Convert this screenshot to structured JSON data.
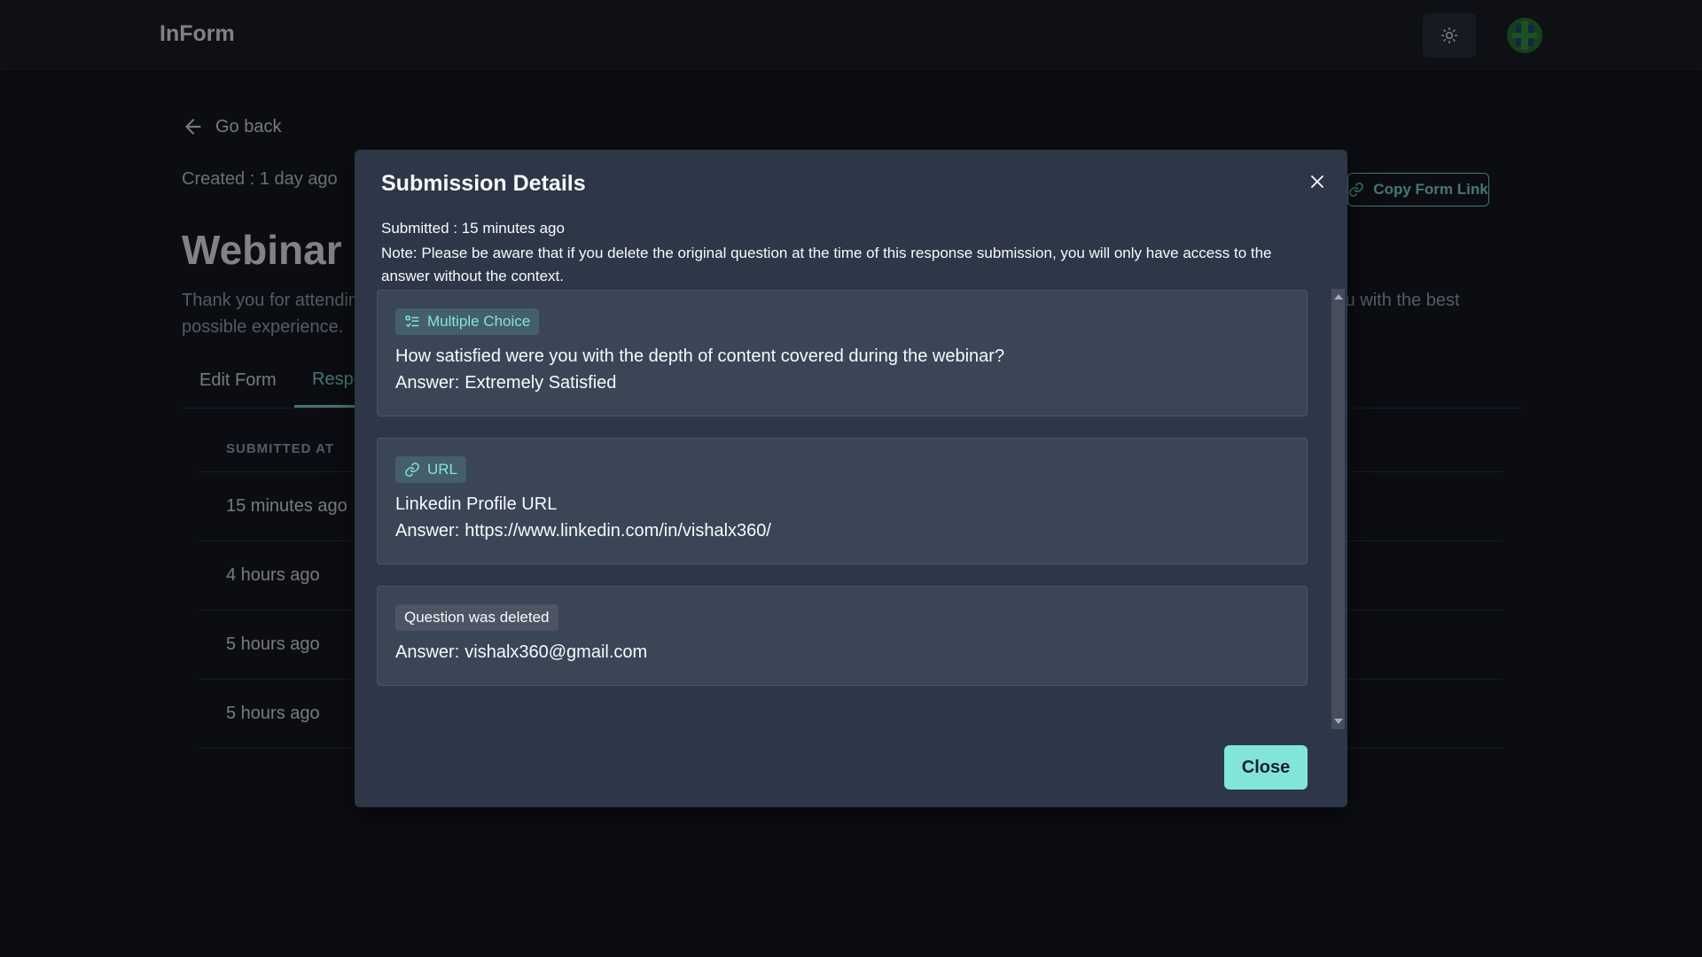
{
  "header": {
    "brand": "InForm",
    "theme_icon": "sun-icon",
    "avatar_icon": "user-avatar"
  },
  "page": {
    "go_back": "Go back",
    "created": "Created : 1 day ago",
    "copy_link": "Copy Form Link",
    "title": "Webinar F",
    "description": "Thank you for attending our webinar! We value your feedback and want to know about your experience. Please fill out this form to help us provide you with the best possible experience.",
    "tabs": [
      "Edit Form",
      "Responses"
    ]
  },
  "table": {
    "header": "SUBMITTED AT",
    "rows": [
      "15 minutes ago",
      "4 hours ago",
      "5 hours ago",
      "5 hours ago"
    ]
  },
  "modal": {
    "title": "Submission Details",
    "submitted": "Submitted : 15 minutes ago",
    "note": "Note: Please be aware that if you delete the original question at the time of this response submission, you will only have access to the answer without the context.",
    "answer_prefix": "Answer:",
    "cards": [
      {
        "type": "Multiple Choice",
        "icon": "list-check-icon",
        "question": "How satisfied were you with the depth of content covered during the webinar?",
        "answer": "Extremely Satisfied"
      },
      {
        "type": "URL",
        "icon": "link-icon",
        "question": "Linkedin Profile URL",
        "answer": "https://www.linkedin.com/in/vishalx360/"
      },
      {
        "type": "Question was deleted",
        "answer": "vishalx360@gmail.com"
      }
    ],
    "close": "Close"
  },
  "colors": {
    "accent": "#81e6d9",
    "background": "#171923",
    "modal": "#2d3748"
  }
}
